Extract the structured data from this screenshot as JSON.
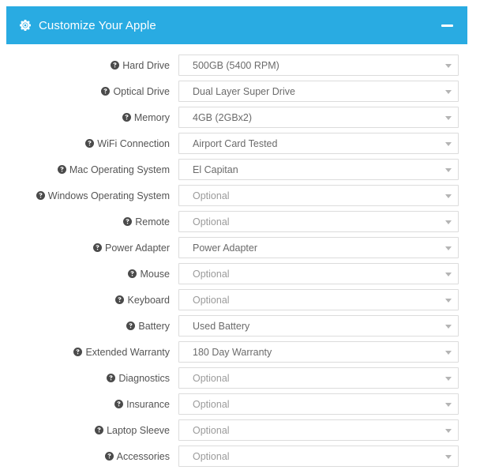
{
  "panel": {
    "title": "Customize Your Apple",
    "gear_icon": "gear-icon",
    "minimize_label": "minimize",
    "accent_color": "#29abe2",
    "label_color": "#555555",
    "value_color": "#6b6b6b",
    "placeholder_color": "#9b9b9b",
    "border_color": "#dcdcdc"
  },
  "form": {
    "help_icon": "question-circle-icon",
    "caret_icon": "chevron-down-icon",
    "rows": [
      {
        "label": "Hard Drive",
        "value": "500GB (5400 RPM)",
        "is_placeholder": false
      },
      {
        "label": "Optical Drive",
        "value": "Dual Layer Super Drive",
        "is_placeholder": false
      },
      {
        "label": "Memory",
        "value": "4GB (2GBx2)",
        "is_placeholder": false
      },
      {
        "label": "WiFi Connection",
        "value": "Airport Card Tested",
        "is_placeholder": false
      },
      {
        "label": "Mac Operating System",
        "value": "El Capitan",
        "is_placeholder": false
      },
      {
        "label": "Windows Operating System",
        "value": "Optional",
        "is_placeholder": true
      },
      {
        "label": "Remote",
        "value": "Optional",
        "is_placeholder": true
      },
      {
        "label": "Power Adapter",
        "value": "Power Adapter",
        "is_placeholder": false
      },
      {
        "label": "Mouse",
        "value": "Optional",
        "is_placeholder": true
      },
      {
        "label": "Keyboard",
        "value": "Optional",
        "is_placeholder": true
      },
      {
        "label": "Battery",
        "value": "Used Battery",
        "is_placeholder": false
      },
      {
        "label": "Extended Warranty",
        "value": "180 Day Warranty",
        "is_placeholder": false
      },
      {
        "label": "Diagnostics",
        "value": "Optional",
        "is_placeholder": true
      },
      {
        "label": "Insurance",
        "value": "Optional",
        "is_placeholder": true
      },
      {
        "label": "Laptop Sleeve",
        "value": "Optional",
        "is_placeholder": true
      },
      {
        "label": "Accessories",
        "value": "Optional",
        "is_placeholder": true
      }
    ]
  }
}
